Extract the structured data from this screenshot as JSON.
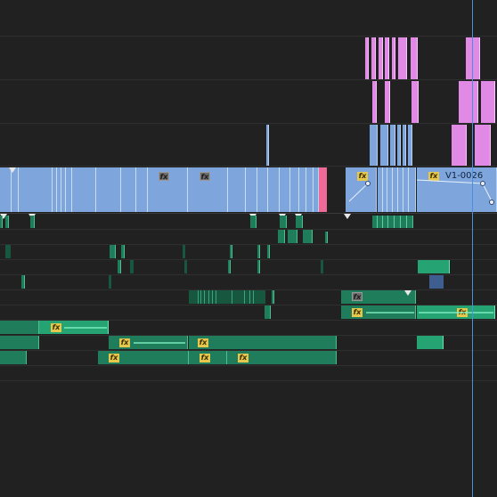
{
  "timeline": {
    "clip_label": "V1-0026",
    "fx_label": "fx",
    "colors": {
      "background": "#212121",
      "video_clip": "#7ea6dc",
      "nested_clip": "#e08ae6",
      "audio_clip": "#1f7d5c",
      "audio_clip_selected": "#26a373",
      "fx_badge": "#e6c74d",
      "playhead": "#4a90e0"
    },
    "icons": {
      "fx_badge": "fx-badge-icon",
      "marker": "clip-marker-icon",
      "keyframe": "keyframe-icon"
    }
  }
}
